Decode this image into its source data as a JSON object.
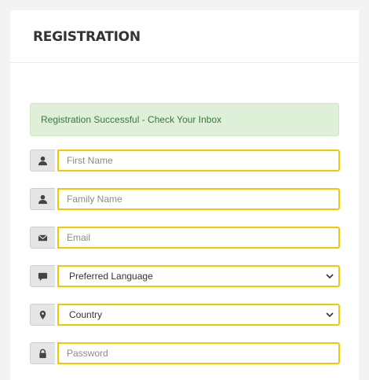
{
  "header": {
    "title": "REGISTRATION"
  },
  "alert": {
    "message": "Registration Successful - Check Your Inbox"
  },
  "fields": {
    "first_name": {
      "placeholder": "First Name",
      "icon": "user-icon"
    },
    "family_name": {
      "placeholder": "Family Name",
      "icon": "user-icon"
    },
    "email": {
      "placeholder": "Email",
      "icon": "envelope-icon"
    },
    "language": {
      "selected": "Preferred Language",
      "icon": "comment-icon"
    },
    "country": {
      "selected": "Country",
      "icon": "map-marker-icon"
    },
    "password": {
      "placeholder": "Password",
      "icon": "lock-icon"
    }
  },
  "colors": {
    "accent_border": "#f0c900",
    "alert_bg": "#dff0d8",
    "alert_text": "#3c763d"
  }
}
